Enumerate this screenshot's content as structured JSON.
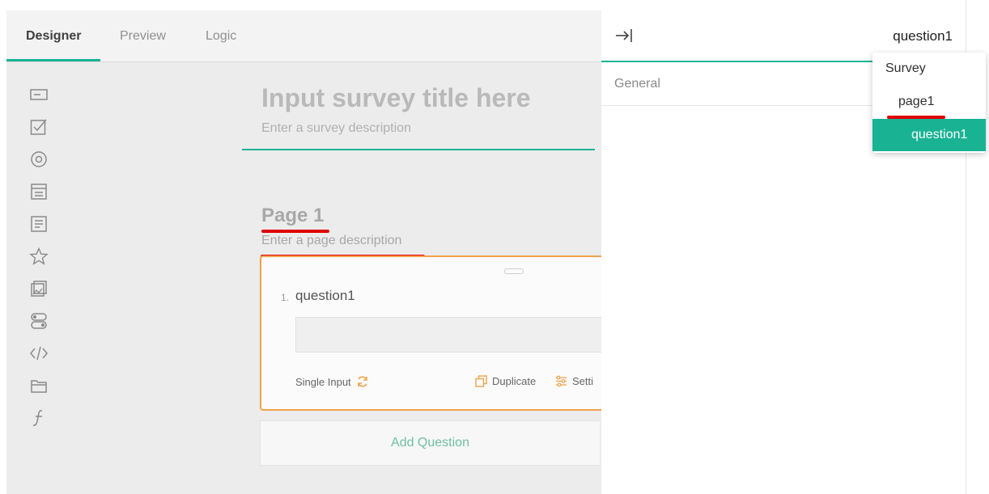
{
  "designer": {
    "tabs": [
      {
        "label": "Designer",
        "active": true
      },
      {
        "label": "Preview",
        "active": false
      },
      {
        "label": "Logic",
        "active": false
      }
    ],
    "toolbox_icons": [
      "single-input-icon",
      "checkbox-icon",
      "radiogroup-icon",
      "dropdown-icon",
      "comment-icon",
      "rating-icon",
      "image-picker-icon",
      "boolean-icon",
      "html-icon",
      "panel-icon",
      "expression-icon"
    ]
  },
  "survey": {
    "title_placeholder": "Input survey title here",
    "description_placeholder": "Enter a survey description"
  },
  "page": {
    "title": "Page 1",
    "description_placeholder": "Enter a page description"
  },
  "question": {
    "number": "1.",
    "title": "question1",
    "type_label": "Single Input",
    "duplicate_label": "Duplicate",
    "settings_label": "Setti"
  },
  "add_question_label": "Add Question",
  "property_panel": {
    "selected_object": "question1",
    "general_tab": "General",
    "dropdown_items": [
      {
        "label": "Survey",
        "selected": false
      },
      {
        "label": "page1",
        "selected": false
      },
      {
        "label": "question1",
        "selected": true
      }
    ]
  },
  "colors": {
    "accent": "#19b394",
    "question_border": "#f2a24b",
    "annotation": "#e00000"
  }
}
